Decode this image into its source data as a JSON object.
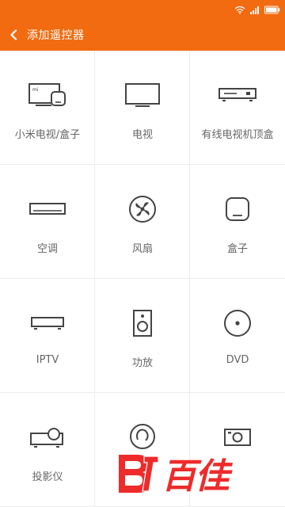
{
  "status_bar": {
    "icons": [
      "wifi-icon",
      "signal-icon",
      "battery-icon"
    ]
  },
  "app_bar": {
    "title": "添加遥控器",
    "back_icon": "chevron-left-icon",
    "color": "#f26b10"
  },
  "devices": [
    {
      "label": "小米电视/盒子",
      "icon": "mi-tv-box-icon"
    },
    {
      "label": "电视",
      "icon": "tv-icon"
    },
    {
      "label": "有线电视机顶盒",
      "icon": "set-top-box-icon"
    },
    {
      "label": "空调",
      "icon": "air-conditioner-icon"
    },
    {
      "label": "风扇",
      "icon": "fan-icon"
    },
    {
      "label": "盒子",
      "icon": "box-icon"
    },
    {
      "label": "IPTV",
      "icon": "iptv-icon"
    },
    {
      "label": "功放",
      "icon": "amplifier-icon"
    },
    {
      "label": "DVD",
      "icon": "dvd-icon"
    },
    {
      "label": "投影仪",
      "icon": "projector-icon"
    },
    {
      "label": "",
      "icon": "light-bulb-icon"
    },
    {
      "label": "",
      "icon": "camera-icon"
    }
  ],
  "watermark": {
    "text": "百佳",
    "color": "#ee2b2b"
  }
}
